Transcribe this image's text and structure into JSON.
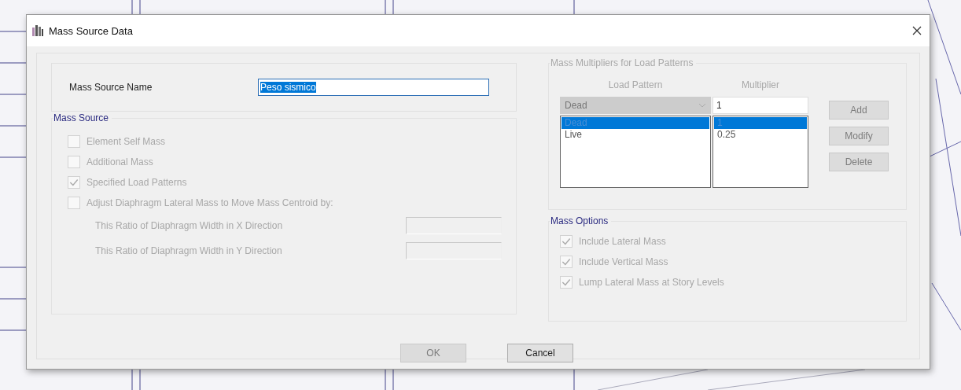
{
  "window": {
    "title": "Mass Source Data"
  },
  "name_field": {
    "label": "Mass Source Name",
    "value": "Peso sismico"
  },
  "mass_source": {
    "title": "Mass Source",
    "options": [
      {
        "label": "Element Self Mass",
        "checked": false
      },
      {
        "label": "Additional Mass",
        "checked": false
      },
      {
        "label": "Specified Load Patterns",
        "checked": true
      },
      {
        "label": "Adjust Diaphragm Lateral Mass to Move Mass Centroid by:",
        "checked": false
      }
    ],
    "ratios": [
      {
        "label": "This Ratio of Diaphragm Width in X Direction"
      },
      {
        "label": "This Ratio of Diaphragm Width in Y Direction"
      }
    ]
  },
  "multipliers": {
    "title": "Mass Multipliers for Load Patterns",
    "columns": [
      "Load Pattern",
      "Multiplier"
    ],
    "pattern_dropdown": "Dead",
    "multiplier_value": "1",
    "rows": [
      {
        "pattern": "Dead",
        "multiplier": "1",
        "selected": true
      },
      {
        "pattern": "Live",
        "multiplier": "0.25",
        "selected": false
      }
    ],
    "buttons": [
      {
        "label": "Add",
        "disabled": true
      },
      {
        "label": "Modify",
        "disabled": true
      },
      {
        "label": "Delete",
        "disabled": true
      }
    ]
  },
  "mass_options": {
    "title": "Mass Options",
    "options": [
      {
        "label": "Include Lateral Mass",
        "checked": true
      },
      {
        "label": "Include Vertical Mass",
        "checked": true
      },
      {
        "label": "Lump Lateral Mass at Story Levels",
        "checked": true
      }
    ]
  },
  "buttons": [
    {
      "label": "OK",
      "disabled": true
    },
    {
      "label": "Cancel",
      "disabled": false
    }
  ]
}
